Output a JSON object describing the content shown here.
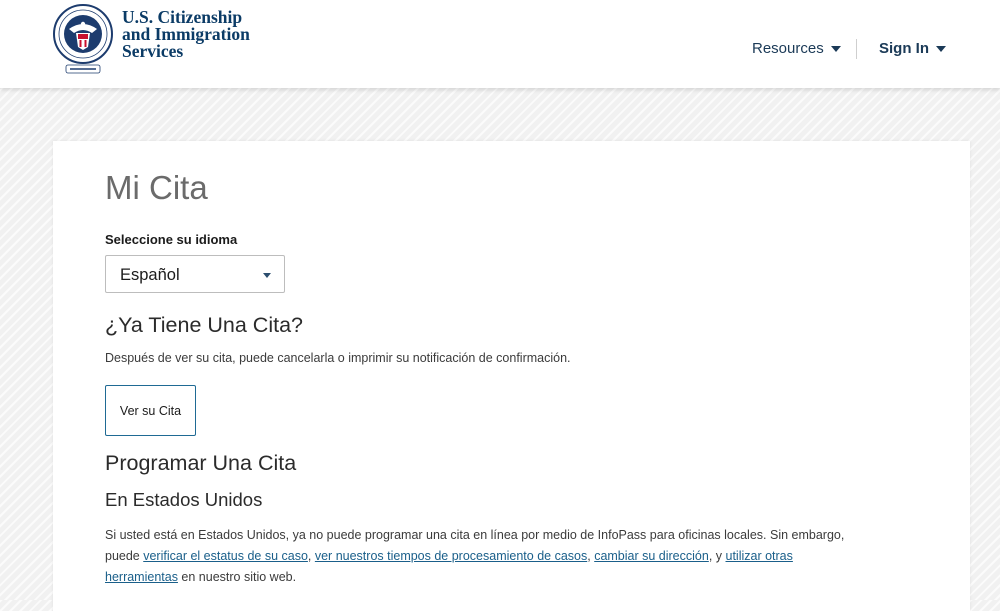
{
  "header": {
    "logo_lines": [
      "U.S. Citizenship",
      "and Immigration",
      "Services"
    ],
    "seal_icon": "dhs-seal-icon",
    "nav": {
      "resources_label": "Resources",
      "signin_label": "Sign In"
    }
  },
  "main": {
    "title": "Mi Cita",
    "language": {
      "label": "Seleccione su idioma",
      "selected": "Español"
    },
    "existing": {
      "heading": "¿Ya Tiene Una Cita?",
      "description": "Después de ver su cita, puede cancelarla o imprimir su notificación de confirmación.",
      "button_label": "Ver su Cita"
    },
    "schedule": {
      "heading": "Programar Una Cita",
      "subheading": "En Estados Unidos",
      "para_intro": "Si usted está en Estados Unidos, ya no puede programar una cita en línea por medio de InfoPass para oficinas locales. Sin embargo, puede ",
      "link_estatus": "verificar el estatus de su caso",
      "sep1": ", ",
      "link_tiempos": "ver nuestros tiempos de procesamiento de casos",
      "sep2": ", ",
      "link_direccion": "cambiar su dirección",
      "sep3": ", y ",
      "link_herramientas": "utilizar otras herramientas",
      "para_outro": " en nuestro sitio web."
    }
  },
  "colors": {
    "brand_navy": "#0b3b66",
    "link": "#1a5f8a",
    "button_border": "#1f6a94",
    "page_bg": "#f1f1f1"
  }
}
